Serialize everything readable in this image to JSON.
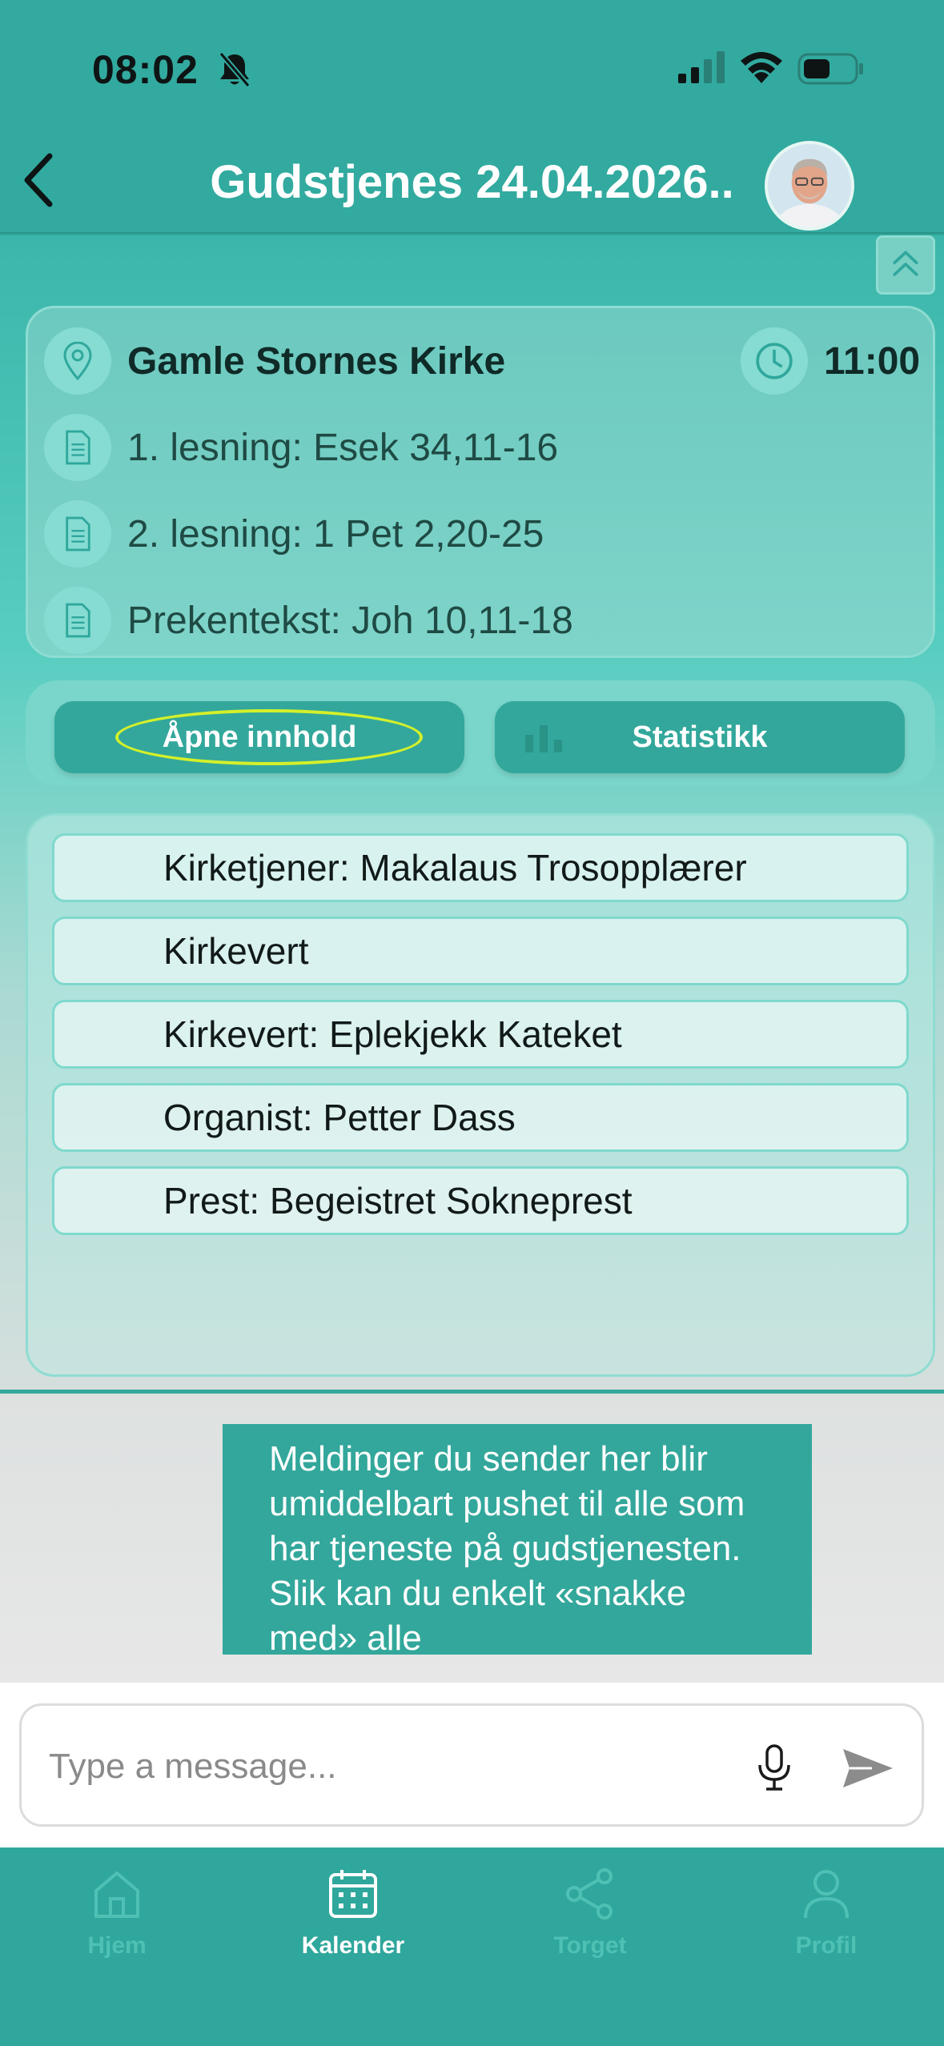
{
  "status_bar": {
    "time": "08:02"
  },
  "header": {
    "title": "Gudstjenes 24.04.2026.."
  },
  "service": {
    "location": "Gamle Stornes Kirke",
    "time": "11:00",
    "readings": [
      "1. lesning: Esek 34,11-16",
      "2. lesning: 1 Pet 2,20-25",
      "Prekentekst: Joh 10,11-18"
    ]
  },
  "actions": {
    "open_content": "Åpne innhold",
    "statistics": "Statistikk"
  },
  "roles": [
    "Kirketjener: Makalaus Trosopplærer",
    "Kirkevert",
    "Kirkevert: Eplekjekk Kateket",
    "Organist: Petter Dass",
    "Prest: Begeistret Sokneprest"
  ],
  "chat": {
    "bubble_text": "Meldinger du sender her blir umiddelbart pushet til alle som har tjeneste på gudstjenesten. Slik kan du enkelt «snakke med» alle",
    "placeholder": "Type a message..."
  },
  "tabs": [
    {
      "label": "Hjem",
      "icon": "home-icon",
      "active": false
    },
    {
      "label": "Kalender",
      "icon": "calendar-icon",
      "active": true
    },
    {
      "label": "Torget",
      "icon": "share-icon",
      "active": false
    },
    {
      "label": "Profil",
      "icon": "user-icon",
      "active": false
    }
  ],
  "colors": {
    "primary": "#2fa79c",
    "button": "#33a79b",
    "highlight": "#d4f02a"
  }
}
